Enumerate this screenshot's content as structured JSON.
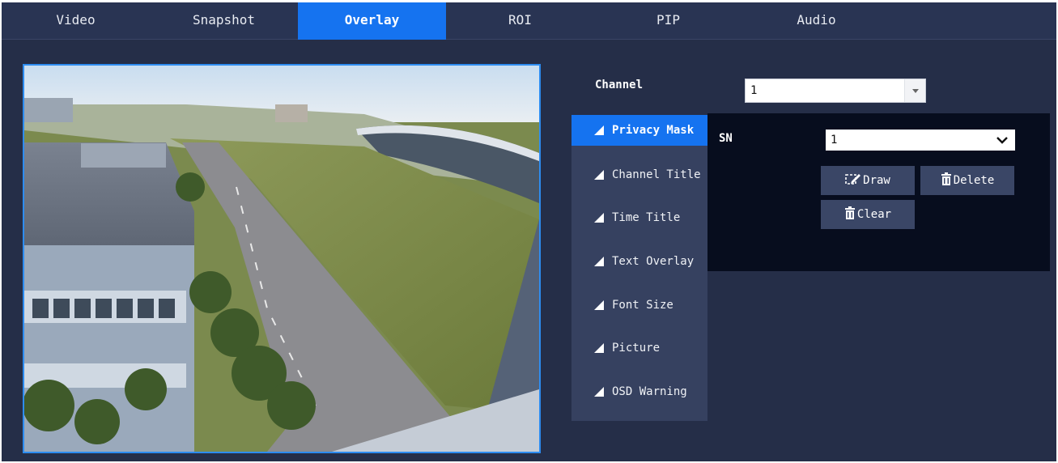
{
  "tabs": [
    {
      "label": "Video",
      "active": false
    },
    {
      "label": "Snapshot",
      "active": false
    },
    {
      "label": "Overlay",
      "active": true
    },
    {
      "label": "ROI",
      "active": false
    },
    {
      "label": "PIP",
      "active": false
    },
    {
      "label": "Audio",
      "active": false
    }
  ],
  "channel": {
    "label": "Channel",
    "value": "1"
  },
  "menu": [
    {
      "label": "Privacy Mask",
      "active": true
    },
    {
      "label": "Channel Title",
      "active": false
    },
    {
      "label": "Time Title",
      "active": false
    },
    {
      "label": "Text Overlay",
      "active": false
    },
    {
      "label": "Font Size",
      "active": false
    },
    {
      "label": "Picture",
      "active": false
    },
    {
      "label": "OSD Warning",
      "active": false
    }
  ],
  "privacy_mask": {
    "sn_label": "SN",
    "sn_value": "1",
    "draw_label": "Draw",
    "delete_label": "Delete",
    "clear_label": "Clear"
  },
  "icons": {
    "menu_bullet": "triangle-icon",
    "draw": "edit-icon",
    "delete": "trash-icon",
    "clear": "trash-icon"
  },
  "colors": {
    "accent": "#1573f0",
    "background": "#252e48",
    "panel": "#070d1e",
    "menu": "#364160"
  }
}
